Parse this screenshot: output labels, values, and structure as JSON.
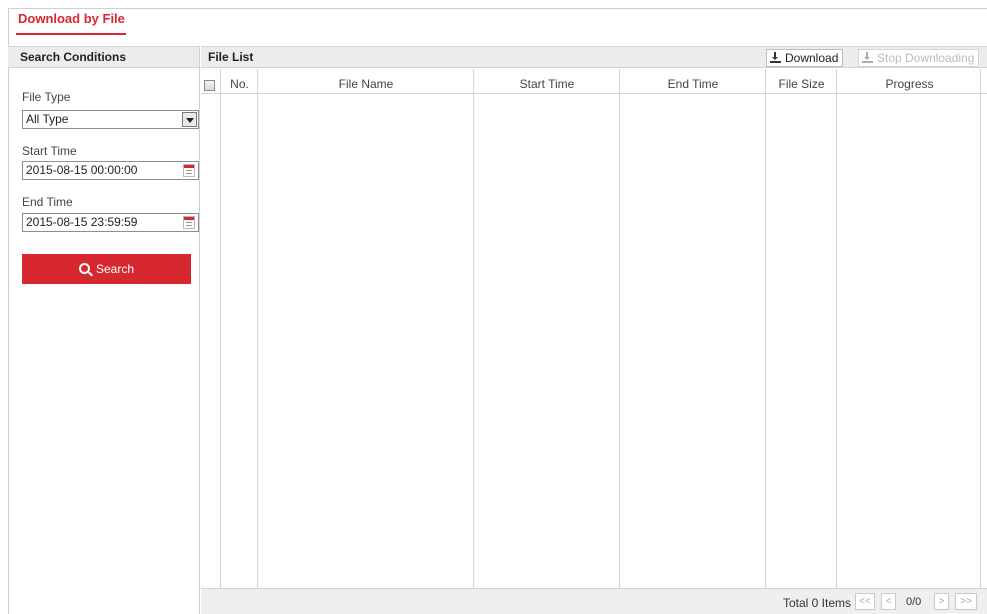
{
  "page_tab": "Download by File",
  "search_panel": {
    "title": "Search Conditions",
    "file_type_label": "File Type",
    "file_type_value": "All Type",
    "start_time_label": "Start Time",
    "start_time_value": "2015-08-15 00:00:00",
    "end_time_label": "End Time",
    "end_time_value": "2015-08-15 23:59:59",
    "search_button": "Search"
  },
  "file_list": {
    "title": "File List",
    "download_button": "Download",
    "stop_button": "Stop Downloading",
    "columns": [
      "No.",
      "File Name",
      "Start Time",
      "End Time",
      "File Size",
      "Progress"
    ],
    "rows": []
  },
  "pagination": {
    "total": "Total 0 Items",
    "first": "<<",
    "prev": "<",
    "info": "0/0",
    "next": ">",
    "last": ">>"
  },
  "colors": {
    "accent": "#d7282f",
    "header_bg": "#ececec"
  }
}
